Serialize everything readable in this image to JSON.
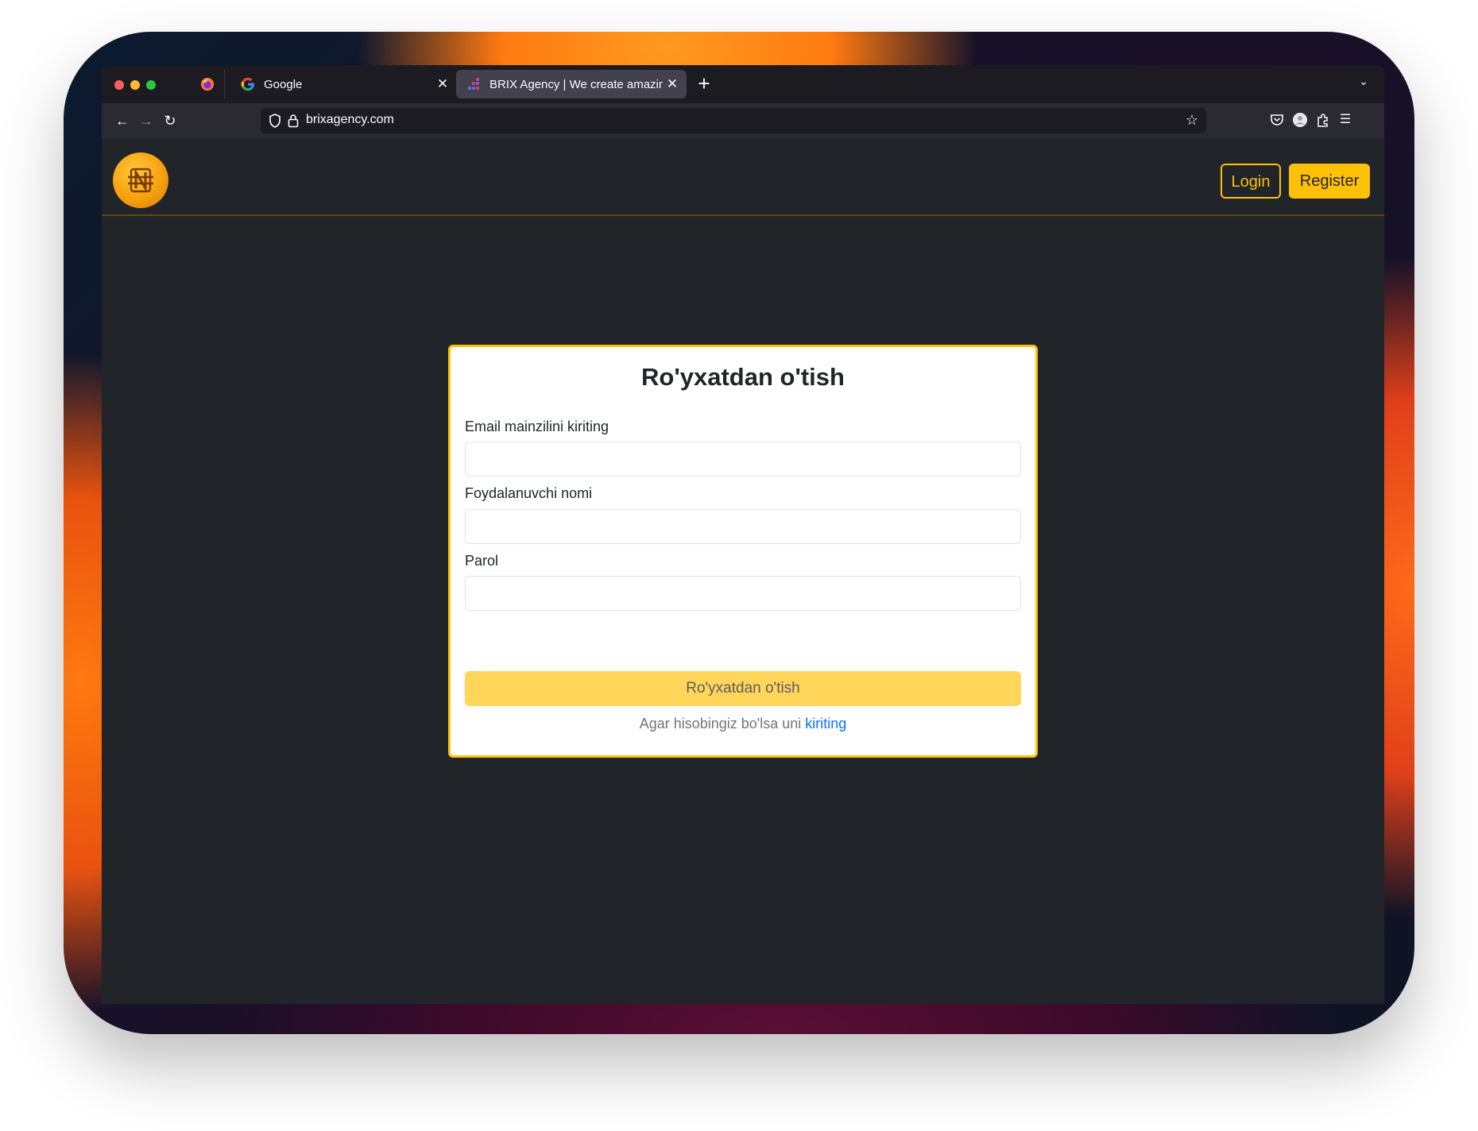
{
  "browser": {
    "tabs": [
      {
        "label": "Google",
        "favicon": "google-icon"
      },
      {
        "label": "BRIX Agency | We create amazing",
        "favicon": "brix-icon",
        "active": true
      }
    ],
    "url": "brixagency.com",
    "icons": {
      "back": "←",
      "forward": "→",
      "reload": "↻",
      "star": "☆",
      "close": "✕",
      "new_tab": "+",
      "tab_list": "⌄",
      "menu": "☰"
    }
  },
  "header": {
    "login_label": "Login",
    "register_label": "Register",
    "accent_color": "#ffc107"
  },
  "form": {
    "title": "Ro'yxatdan o'tish",
    "fields": [
      {
        "label": "Email mainzilini kiriting",
        "value": ""
      },
      {
        "label": "Foydalanuvchi nomi",
        "value": ""
      },
      {
        "label": "Parol",
        "value": ""
      }
    ],
    "submit_label": "Ro'yxatdan o'tish",
    "footer_text": "Agar hisobingiz bo'lsa uni",
    "footer_link": "kiriting"
  }
}
